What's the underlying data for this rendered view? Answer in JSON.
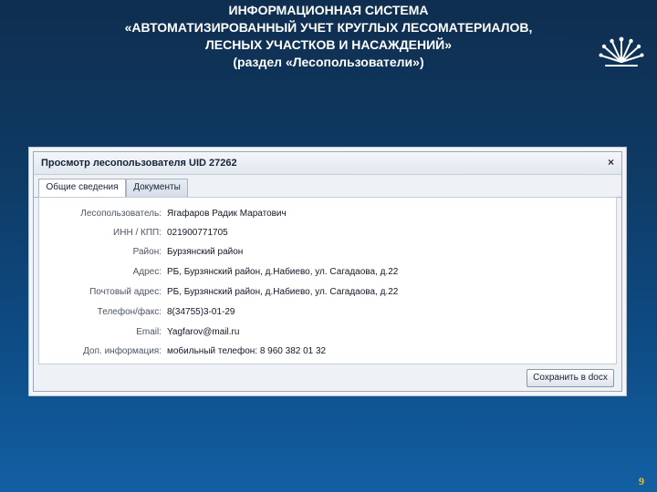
{
  "slide": {
    "title_lines": [
      "ИНФОРМАЦИОННАЯ СИСТЕМА",
      "«АВТОМАТИЗИРОВАННЫЙ УЧЕТ КРУГЛЫХ ЛЕСОМАТЕРИАЛОВ,",
      "ЛЕСНЫХ УЧАСТКОВ И НАСАЖДЕНИЙ»",
      "(раздел «Лесопользователи»)"
    ],
    "page_number": "9",
    "logo_icon": "kurai-flower-icon"
  },
  "window": {
    "title": "Просмотр лесопользователя UID 27262",
    "close_label": "×",
    "tabs": [
      {
        "label": "Общие сведения",
        "active": true
      },
      {
        "label": "Документы",
        "active": false
      }
    ],
    "fields": [
      {
        "label": "Лесопользователь:",
        "value": "Ягафаров Радик Маратович"
      },
      {
        "label": "ИНН / КПП:",
        "value": "021900771705"
      },
      {
        "label": "Район:",
        "value": "Бурзянский район"
      },
      {
        "label": "Адрес:",
        "value": "РБ, Бурзянский район, д.Набиево, ул. Сагадаова, д.22"
      },
      {
        "label": "Почтовый адрес:",
        "value": "РБ, Бурзянский район, д.Набиево, ул. Сагадаова, д.22"
      },
      {
        "label": "Телефон/факс:",
        "value": "8(34755)3-01-29"
      },
      {
        "label": "Email:",
        "value": "Yagfarov@mail.ru"
      },
      {
        "label": "Доп. информация:",
        "value": "мобильный телефон: 8 960 382 01 32"
      }
    ],
    "save_button": "Сохранить в docx"
  },
  "colors": {
    "background_top": "#0f2e4f",
    "background_bottom": "#1260a3",
    "page_number": "#f0c020"
  }
}
